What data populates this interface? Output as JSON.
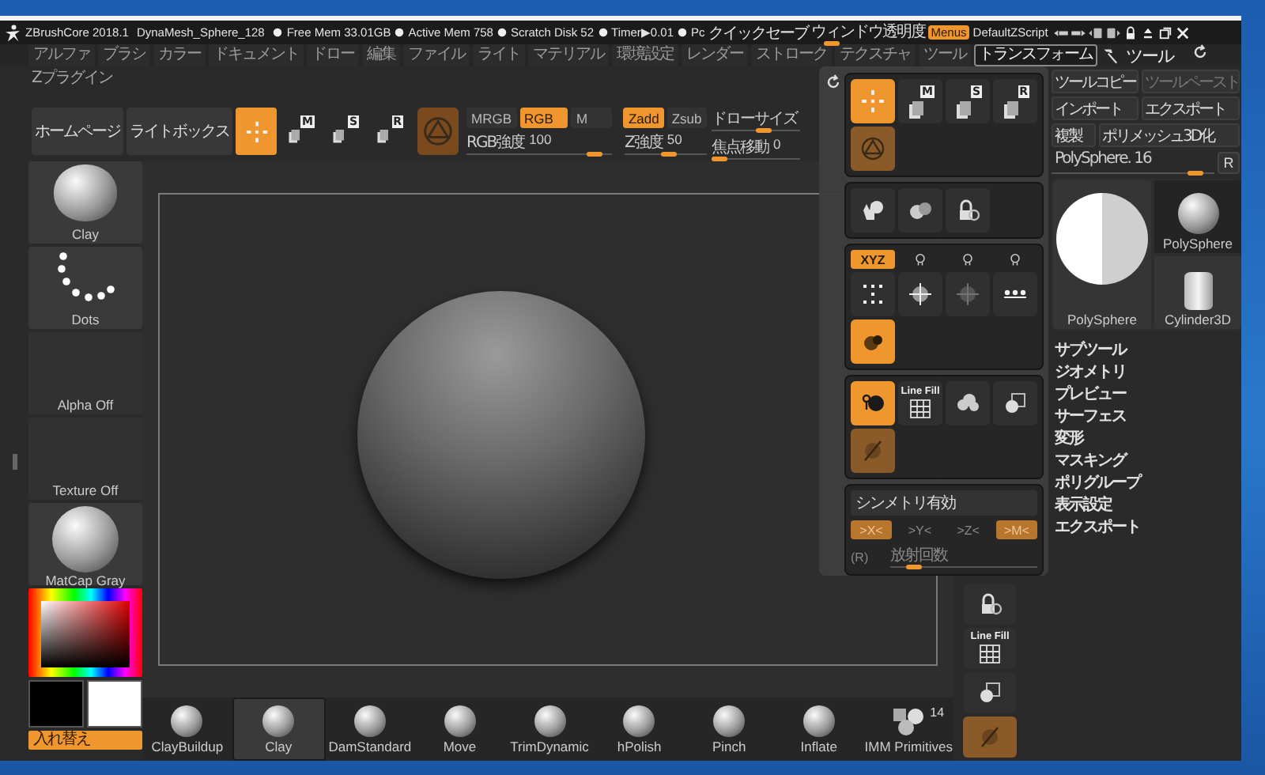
{
  "title_bar": {
    "app": "ZBrushCore 2018.1",
    "document": "DynaMesh_Sphere_128",
    "stats": [
      "Free Mem 33.01GB",
      "Active Mem 758",
      "Scratch Disk 52",
      "Timer▶0.01",
      "Pc"
    ],
    "quicksave": "クイックセーブ",
    "transparency": {
      "label": "ウィンドウ透明度",
      "level": 0.12
    },
    "menus": {
      "label": "Menus",
      "selected": true
    },
    "script": "DefaultZScript"
  },
  "menu_bar": {
    "items": [
      {
        "label": "アルファ",
        "selected": false
      },
      {
        "label": "ブラシ",
        "selected": false
      },
      {
        "label": "カラー",
        "selected": false
      },
      {
        "label": "ドキュメント",
        "selected": false
      },
      {
        "label": "ドロー",
        "selected": false
      },
      {
        "label": "編集",
        "selected": false
      },
      {
        "label": "ファイル",
        "selected": false
      },
      {
        "label": "ライト",
        "selected": false
      },
      {
        "label": "マテリアル",
        "selected": false
      },
      {
        "label": "環境設定",
        "selected": false
      },
      {
        "label": "レンダー",
        "selected": false
      },
      {
        "label": "ストローク",
        "selected": false
      },
      {
        "label": "テクスチャ",
        "selected": false
      },
      {
        "label": "ツール",
        "selected": false
      },
      {
        "label": "トランスフォーム",
        "selected": true
      }
    ],
    "plugins": "Zプラグイン",
    "tool_header": "ツール"
  },
  "toolbar": {
    "pages": [
      "ホームページ",
      "ライトボックス"
    ],
    "modes": [
      {
        "kind": "crosshair",
        "selected": true
      },
      {
        "kind": "key",
        "key": "M",
        "selected": false
      },
      {
        "kind": "key",
        "key": "S",
        "selected": false
      },
      {
        "kind": "key",
        "key": "R",
        "selected": false
      }
    ],
    "color_modes": [
      {
        "label": "MRGB",
        "selected": false
      },
      {
        "label": "RGB",
        "selected": true
      },
      {
        "label": "M",
        "selected": false
      }
    ],
    "z_modes": [
      {
        "label": "Zadd",
        "selected": true
      },
      {
        "label": "Zsub",
        "selected": false
      }
    ],
    "sliders": [
      {
        "label": "RGB強度",
        "value": "100",
        "level": 0.93
      },
      {
        "label": "Z強度",
        "value": "50",
        "level": 0.55
      }
    ],
    "draw_size": {
      "label": "ドローサイズ",
      "level": 0.6
    },
    "focal": {
      "label": "焦点移動",
      "value": "0",
      "level": 0
    }
  },
  "left_shelf": {
    "items": [
      {
        "kind": "brush",
        "label": "Clay"
      },
      {
        "kind": "stroke",
        "label": "Dots"
      },
      {
        "kind": "alpha",
        "label": "Alpha Off"
      },
      {
        "kind": "texture",
        "label": "Texture Off"
      },
      {
        "kind": "material",
        "label": "MatCap Gray"
      }
    ],
    "swap": "入れ替え"
  },
  "brushes": [
    {
      "label": "ClayBuildup",
      "kind": "sphere",
      "selected": false
    },
    {
      "label": "Clay",
      "kind": "sphere",
      "selected": true
    },
    {
      "label": "DamStandard",
      "kind": "sphere",
      "selected": false
    },
    {
      "label": "Move",
      "kind": "sphere",
      "selected": false
    },
    {
      "label": "TrimDynamic",
      "kind": "sphere",
      "selected": false
    },
    {
      "label": "hPolish",
      "kind": "sphere",
      "selected": false
    },
    {
      "label": "Pinch",
      "kind": "sphere",
      "selected": false
    },
    {
      "label": "Inflate",
      "kind": "sphere",
      "selected": false
    },
    {
      "label": "IMM Primitives",
      "kind": "primitives",
      "count": "14",
      "selected": false
    }
  ],
  "right_shelf": [
    {
      "kind": "lock",
      "selected": false,
      "disabled": false
    },
    {
      "kind": "grid",
      "caption": "Line Fill",
      "selected": false,
      "disabled": false
    },
    {
      "kind": "squares",
      "selected": false,
      "disabled": false
    },
    {
      "kind": "ghost",
      "selected": true,
      "disabled": true
    }
  ],
  "tool_panel": {
    "buttons": [
      {
        "label": "ツールコピー",
        "disabled": false
      },
      {
        "label": "ツールペースト",
        "disabled": true
      },
      {
        "label": "インポート",
        "disabled": false
      },
      {
        "label": "エクスポート",
        "disabled": false
      },
      {
        "label": "複製",
        "disabled": false
      },
      {
        "label": "ポリメッシュ3D化",
        "disabled": false
      }
    ],
    "slider": {
      "label": "PolySphere. 16",
      "level": 0.92,
      "reset": "R"
    },
    "tools": [
      {
        "label": "PolySphere",
        "kind": "half-sphere",
        "selected": false
      },
      {
        "label": "PolySphere",
        "kind": "sphere",
        "selected": true
      },
      {
        "label": "Cylinder3D",
        "kind": "cylinder",
        "selected": false
      }
    ],
    "subpalettes": [
      "サブツール",
      "ジオメトリ",
      "プレビュー",
      "サーフェス",
      "変形",
      "マスキング",
      "ポリグループ",
      "表示設定",
      "エクスポート"
    ]
  },
  "transform_popup": {
    "groups": [
      {
        "kind": "tiles",
        "items": [
          {
            "kind": "crosshair",
            "selected": true,
            "disabled": false
          },
          {
            "kind": "key",
            "key": "M",
            "selected": false,
            "disabled": false
          },
          {
            "kind": "key",
            "key": "S",
            "selected": false,
            "disabled": false
          },
          {
            "kind": "key",
            "key": "R",
            "selected": false,
            "disabled": false
          },
          {
            "kind": "ring",
            "selected": true,
            "disabled": true
          }
        ]
      },
      {
        "kind": "tiles",
        "items": [
          {
            "kind": "hand",
            "selected": false,
            "disabled": false
          },
          {
            "kind": "spheres",
            "selected": false,
            "disabled": false
          },
          {
            "kind": "lock",
            "selected": false,
            "disabled": false
          }
        ]
      },
      {
        "kind": "tiles",
        "axes": [
          {
            "label": "XYZ",
            "selected": true
          },
          {
            "selected": false
          },
          {
            "selected": false
          },
          {
            "selected": false
          }
        ],
        "items": [
          {
            "kind": "frame",
            "selected": false,
            "disabled": false
          },
          {
            "kind": "target",
            "selected": false,
            "disabled": false
          },
          {
            "kind": "target",
            "selected": false,
            "disabled": true
          },
          {
            "kind": "align",
            "selected": false,
            "disabled": false
          },
          {
            "kind": "blobs",
            "selected": true,
            "disabled": false
          }
        ]
      },
      {
        "kind": "tiles",
        "items": [
          {
            "kind": "local",
            "selected": true,
            "disabled": false
          },
          {
            "kind": "grid",
            "caption": "Line Fill",
            "selected": false,
            "disabled": false
          },
          {
            "kind": "cloud",
            "selected": false,
            "disabled": false
          },
          {
            "kind": "squares",
            "selected": false,
            "disabled": false
          },
          {
            "kind": "ghost",
            "selected": true,
            "disabled": true
          }
        ]
      },
      {
        "kind": "symmetry",
        "title": "シンメトリ有効",
        "axes": [
          {
            "label": ">X<",
            "selected": true
          },
          {
            "label": ">Y<",
            "selected": false
          },
          {
            "label": ">Z<",
            "selected": false
          },
          {
            "label": ">M<",
            "selected": true
          }
        ],
        "radial": "(R)",
        "slider": {
          "label": "放射回数",
          "level": 0.12
        }
      }
    ]
  }
}
